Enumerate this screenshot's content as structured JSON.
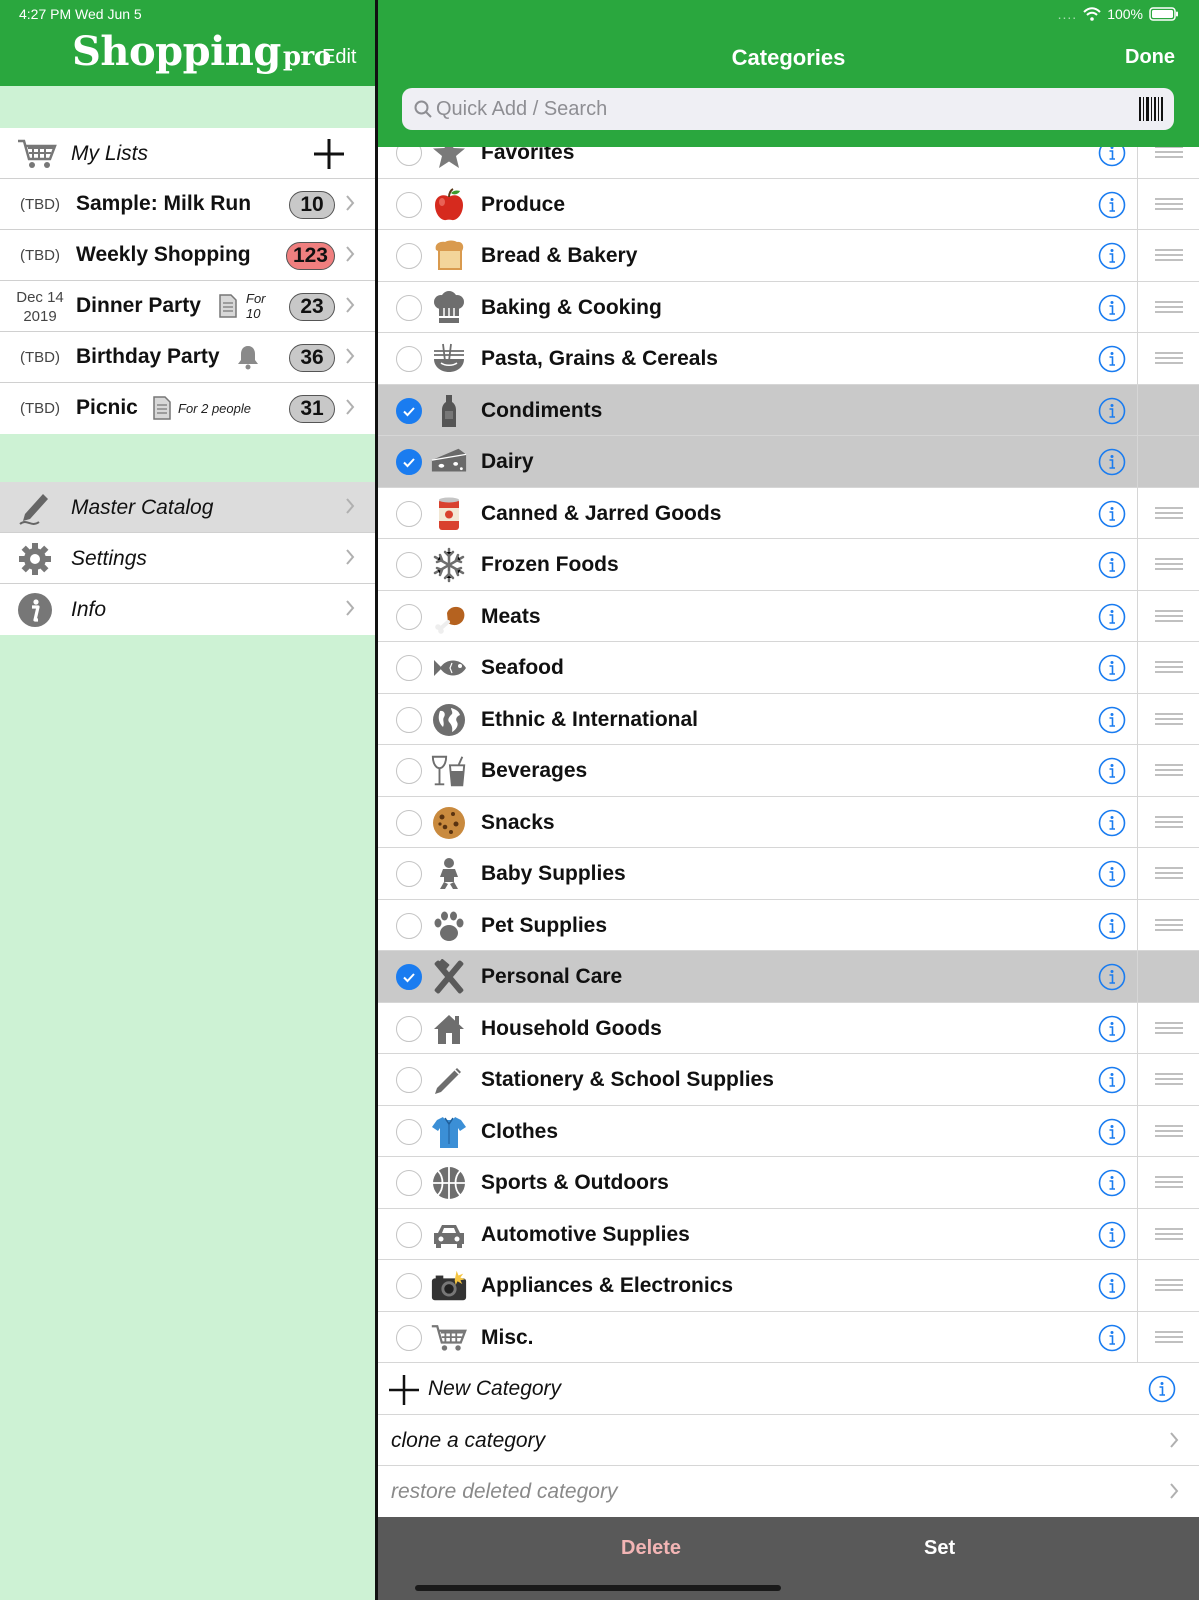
{
  "status": {
    "time_date": "4:27 PM   Wed Jun 5",
    "battery": "100%"
  },
  "sidebar": {
    "app_title": "Shopping",
    "app_title_suffix": "pro",
    "edit_label": "Edit",
    "my_lists_label": "My Lists",
    "lists": [
      {
        "date": "(TBD)",
        "name": "Sample: Milk Run",
        "count": "10",
        "badge_color": "#c8c8c8"
      },
      {
        "date": "(TBD)",
        "name": "Weekly Shopping",
        "count": "123",
        "badge_color": "#f07f7f"
      },
      {
        "date_line1": "Dec 14",
        "date_line2": "2019",
        "name": "Dinner Party",
        "note_line1": "For",
        "note_line2": "10",
        "count": "23",
        "badge_color": "#c8c8c8"
      },
      {
        "date": "(TBD)",
        "name": "Birthday Party",
        "count": "36",
        "badge_color": "#c8c8c8"
      },
      {
        "date": "(TBD)",
        "name": "Picnic",
        "note": "For 2 people",
        "count": "31",
        "badge_color": "#c8c8c8"
      }
    ],
    "nav": [
      {
        "label": "Master Catalog",
        "icon": "pen-icon",
        "selected": true
      },
      {
        "label": "Settings",
        "icon": "gear-icon"
      },
      {
        "label": "Info",
        "icon": "info-icon"
      }
    ]
  },
  "main": {
    "title": "Categories",
    "done_label": "Done",
    "search_placeholder": "Quick Add / Search",
    "categories": [
      {
        "name": "Favorites",
        "icon": "star-icon",
        "checked": false
      },
      {
        "name": "Produce",
        "icon": "apple-icon",
        "checked": false
      },
      {
        "name": "Bread & Bakery",
        "icon": "bread-icon",
        "checked": false
      },
      {
        "name": "Baking & Cooking",
        "icon": "chef-hat-icon",
        "checked": false
      },
      {
        "name": "Pasta, Grains & Cereals",
        "icon": "noodle-bowl-icon",
        "checked": false
      },
      {
        "name": "Condiments",
        "icon": "bottle-icon",
        "checked": true
      },
      {
        "name": "Dairy",
        "icon": "cheese-icon",
        "checked": true
      },
      {
        "name": "Canned & Jarred Goods",
        "icon": "can-icon",
        "checked": false
      },
      {
        "name": "Frozen Foods",
        "icon": "snowflake-icon",
        "checked": false
      },
      {
        "name": "Meats",
        "icon": "drumstick-icon",
        "checked": false
      },
      {
        "name": "Seafood",
        "icon": "fish-icon",
        "checked": false
      },
      {
        "name": "Ethnic & International",
        "icon": "globe-icon",
        "checked": false
      },
      {
        "name": "Beverages",
        "icon": "drinks-icon",
        "checked": false
      },
      {
        "name": "Snacks",
        "icon": "cookie-icon",
        "checked": false
      },
      {
        "name": "Baby Supplies",
        "icon": "baby-icon",
        "checked": false
      },
      {
        "name": "Pet Supplies",
        "icon": "paw-icon",
        "checked": false
      },
      {
        "name": "Personal Care",
        "icon": "razor-brush-icon",
        "checked": true
      },
      {
        "name": "Household Goods",
        "icon": "house-icon",
        "checked": false
      },
      {
        "name": "Stationery & School Supplies",
        "icon": "pencil-icon",
        "checked": false
      },
      {
        "name": "Clothes",
        "icon": "shirt-icon",
        "checked": false
      },
      {
        "name": "Sports & Outdoors",
        "icon": "basketball-icon",
        "checked": false
      },
      {
        "name": "Automotive Supplies",
        "icon": "car-icon",
        "checked": false
      },
      {
        "name": "Appliances & Electronics",
        "icon": "camera-icon",
        "checked": false
      },
      {
        "name": "Misc.",
        "icon": "cart-icon",
        "checked": false
      }
    ],
    "new_category_label": "New Category",
    "clone_label": "clone a category",
    "restore_label": "restore deleted category",
    "toolbar": {
      "delete_label": "Delete",
      "set_label": "Set"
    }
  },
  "colors": {
    "brand_green": "#2aa73e",
    "sidebar_bg": "#cdf2d4",
    "accent_blue": "#1a7cf0",
    "toolbar_bg": "#595959"
  }
}
